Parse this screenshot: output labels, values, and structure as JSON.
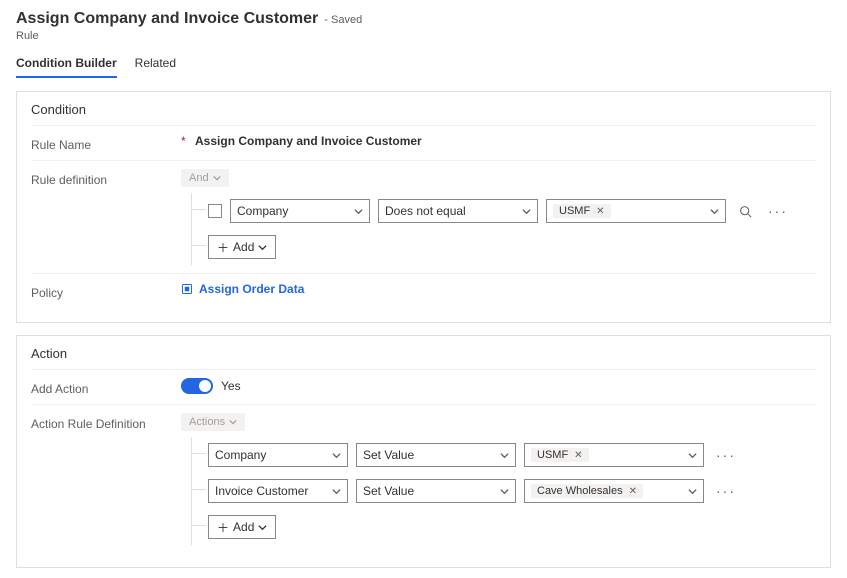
{
  "header": {
    "title": "Assign Company and Invoice Customer",
    "status": "- Saved",
    "entity": "Rule"
  },
  "tabs": {
    "condition_builder": "Condition Builder",
    "related": "Related"
  },
  "condition": {
    "panel_title": "Condition",
    "labels": {
      "rule_name": "Rule Name",
      "rule_definition": "Rule definition",
      "policy": "Policy"
    },
    "rule_name_value": "Assign Company and Invoice Customer",
    "root_op": "And",
    "rows": [
      {
        "field": "Company",
        "operator": "Does not equal",
        "value": "USMF"
      }
    ],
    "add_label": "Add",
    "policy_link": "Assign Order Data"
  },
  "action": {
    "panel_title": "Action",
    "labels": {
      "add_action": "Add Action",
      "action_rule_definition": "Action Rule Definition"
    },
    "toggle_text": "Yes",
    "root_op": "Actions",
    "rows": [
      {
        "field": "Company",
        "operator": "Set Value",
        "value": "USMF"
      },
      {
        "field": "Invoice Customer",
        "operator": "Set Value",
        "value": "Cave Wholesales"
      }
    ],
    "add_label": "Add"
  }
}
